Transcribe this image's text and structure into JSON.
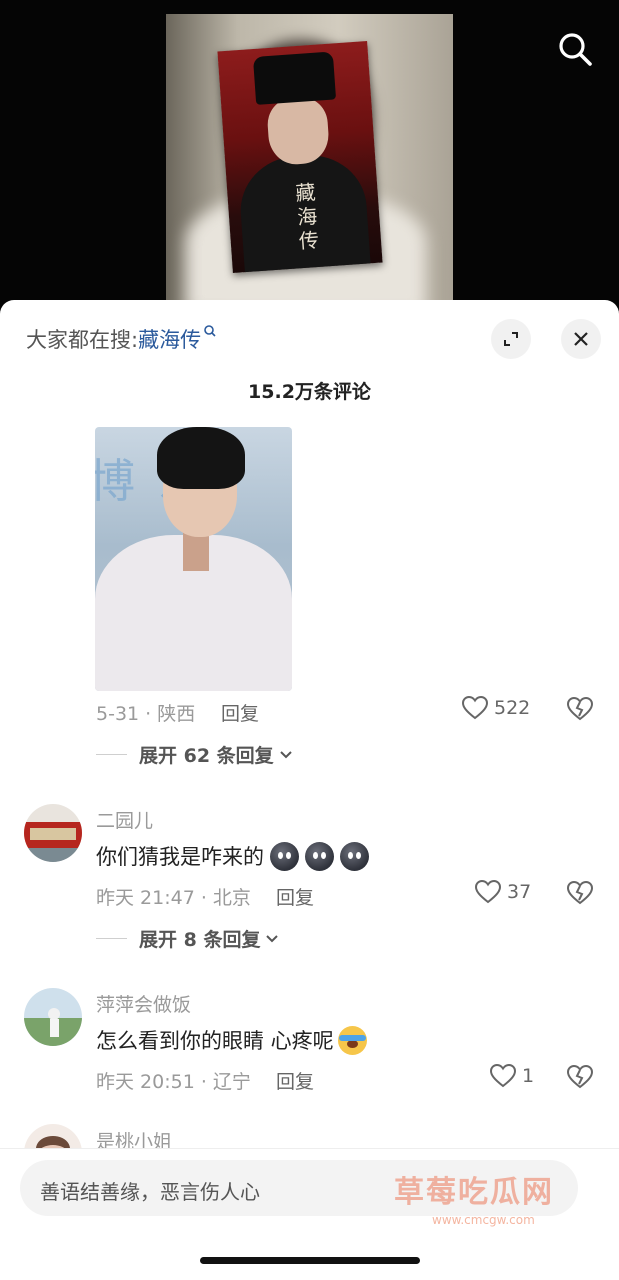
{
  "video": {
    "poster_title": "藏海传",
    "search_icon": "search-icon"
  },
  "sheet": {
    "search_prefix": "大家都在搜:",
    "search_keyword": "藏海传",
    "comment_count": "15.2万条评论",
    "expand_icon": "expand-icon",
    "close_icon": "close-icon"
  },
  "comments": [
    {
      "meta": "5-31 · 陕西",
      "reply_label": "回复",
      "likes": "522",
      "expand_label": "展开 62 条回复"
    },
    {
      "username": "二园儿",
      "text": "你们猜我是咋来的",
      "meta": "昨天 21:47 · 北京",
      "reply_label": "回复",
      "likes": "37",
      "expand_label": "展开 8 条回复"
    },
    {
      "username": "萍萍会做饭",
      "text": "怎么看到你的眼睛 心疼呢",
      "meta": "昨天 20:51 · 辽宁",
      "reply_label": "回复",
      "likes": "1"
    },
    {
      "username": "是桃小姐"
    }
  ],
  "input": {
    "placeholder": "善语结善缘，恶言伤人心"
  },
  "watermark": {
    "text": "草莓吃瓜网",
    "url": "www.cmcgw.com"
  },
  "colors": {
    "keyword": "#2b5a9c",
    "background": "#ffffff"
  }
}
